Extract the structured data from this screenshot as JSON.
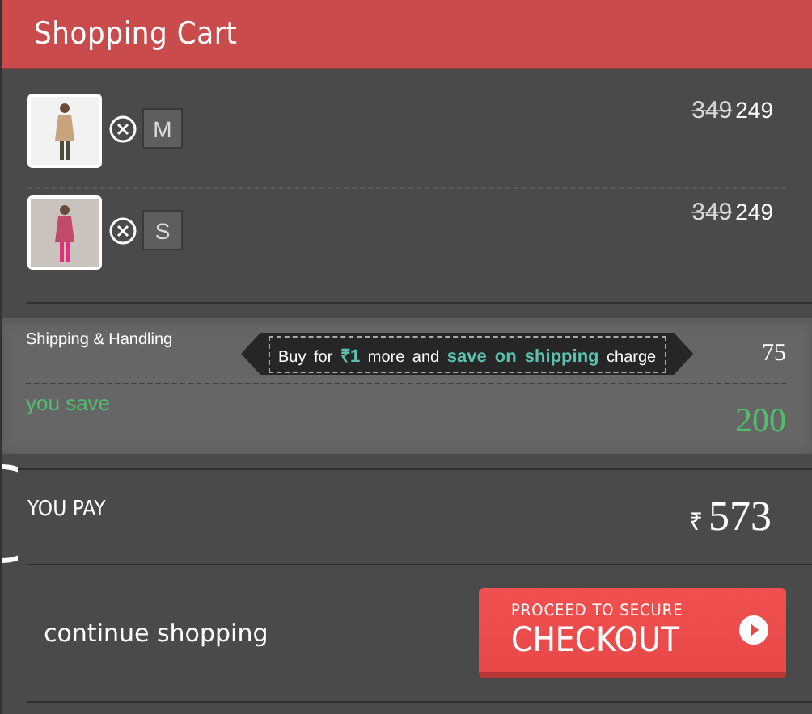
{
  "header": {
    "title": "Shopping Cart"
  },
  "items": [
    {
      "kind": "picture",
      "size": "M",
      "old_price": "349",
      "price": "249"
    },
    {
      "kind": "picture",
      "size": "S",
      "old_price": "349",
      "price": "249"
    }
  ],
  "shipping": {
    "label": "Shipping & Handling",
    "offer": "Buy for **₹1** more and **save on shipping** charge",
    "amount": "75"
  },
  "savings": {
    "label": "you save",
    "amount": "200"
  },
  "total": {
    "label": "YOU PAY",
    "currency": "₹",
    "amount": "573"
  },
  "actions": {
    "continue": "continue shopping",
    "checkout_top": "PROCEED TO SECURE",
    "checkout_main": "CHECKOUT"
  }
}
